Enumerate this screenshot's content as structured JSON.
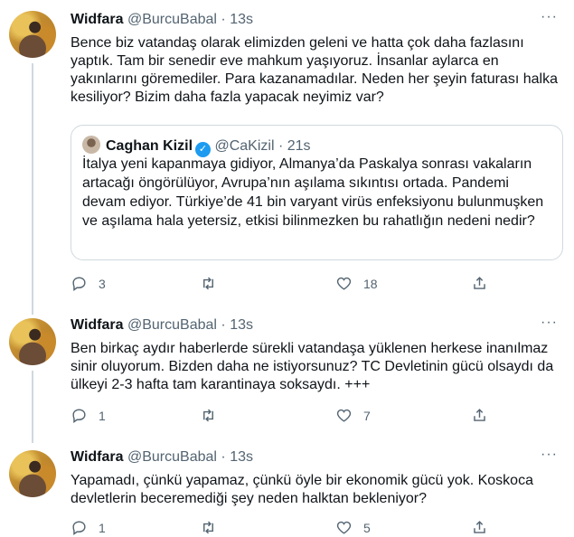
{
  "tweets": [
    {
      "name": "Widfara",
      "handle": "@BurcuBabal",
      "dot": "·",
      "time": "13s",
      "text": "Bence biz vatandaş olarak elimizden geleni ve hatta çok daha fazlasını yaptık. Tam bir senedir eve mahkum yaşıyoruz. İnsanlar aylarca en yakınlarını göremediler. Para kazanamadılar. Neden her şeyin faturası halka kesiliyor? Bizim daha fazla yapacak neyimiz var?",
      "quote": {
        "name": "Caghan Kizil",
        "handle": "@CaKizil",
        "dot": "·",
        "time": "21s",
        "text": "İtalya yeni kapanmaya gidiyor, Almanya’da Paskalya sonrası vakaların artacağı öngörülüyor, Avrupa’nın aşılama sıkıntısı ortada. Pandemi devam ediyor. Türkiye’de 41 bin varyant virüs enfeksiyonu bulunmuşken ve aşılama hala yetersiz, etkisi bilinmezken bu rahatlığın nedeni nedir?"
      },
      "replies": "3",
      "retweets": "",
      "likes": "18"
    },
    {
      "name": "Widfara",
      "handle": "@BurcuBabal",
      "dot": "·",
      "time": "13s",
      "text": "Ben birkaç aydır haberlerde sürekli vatandaşa yüklenen herkese inanılmaz sinir oluyorum. Bizden daha ne istiyorsunuz? TC Devletinin gücü olsaydı da ülkeyi 2-3 hafta tam karantinaya soksaydı. +++",
      "replies": "1",
      "retweets": "",
      "likes": "7"
    },
    {
      "name": "Widfara",
      "handle": "@BurcuBabal",
      "dot": "·",
      "time": "13s",
      "text": "Yapamadı, çünkü yapamaz, çünkü öyle bir ekonomik gücü yok. Koskoca devletlerin beceremediği şey neden halktan bekleniyor?",
      "replies": "1",
      "retweets": "",
      "likes": "5"
    }
  ],
  "more_label": "···"
}
